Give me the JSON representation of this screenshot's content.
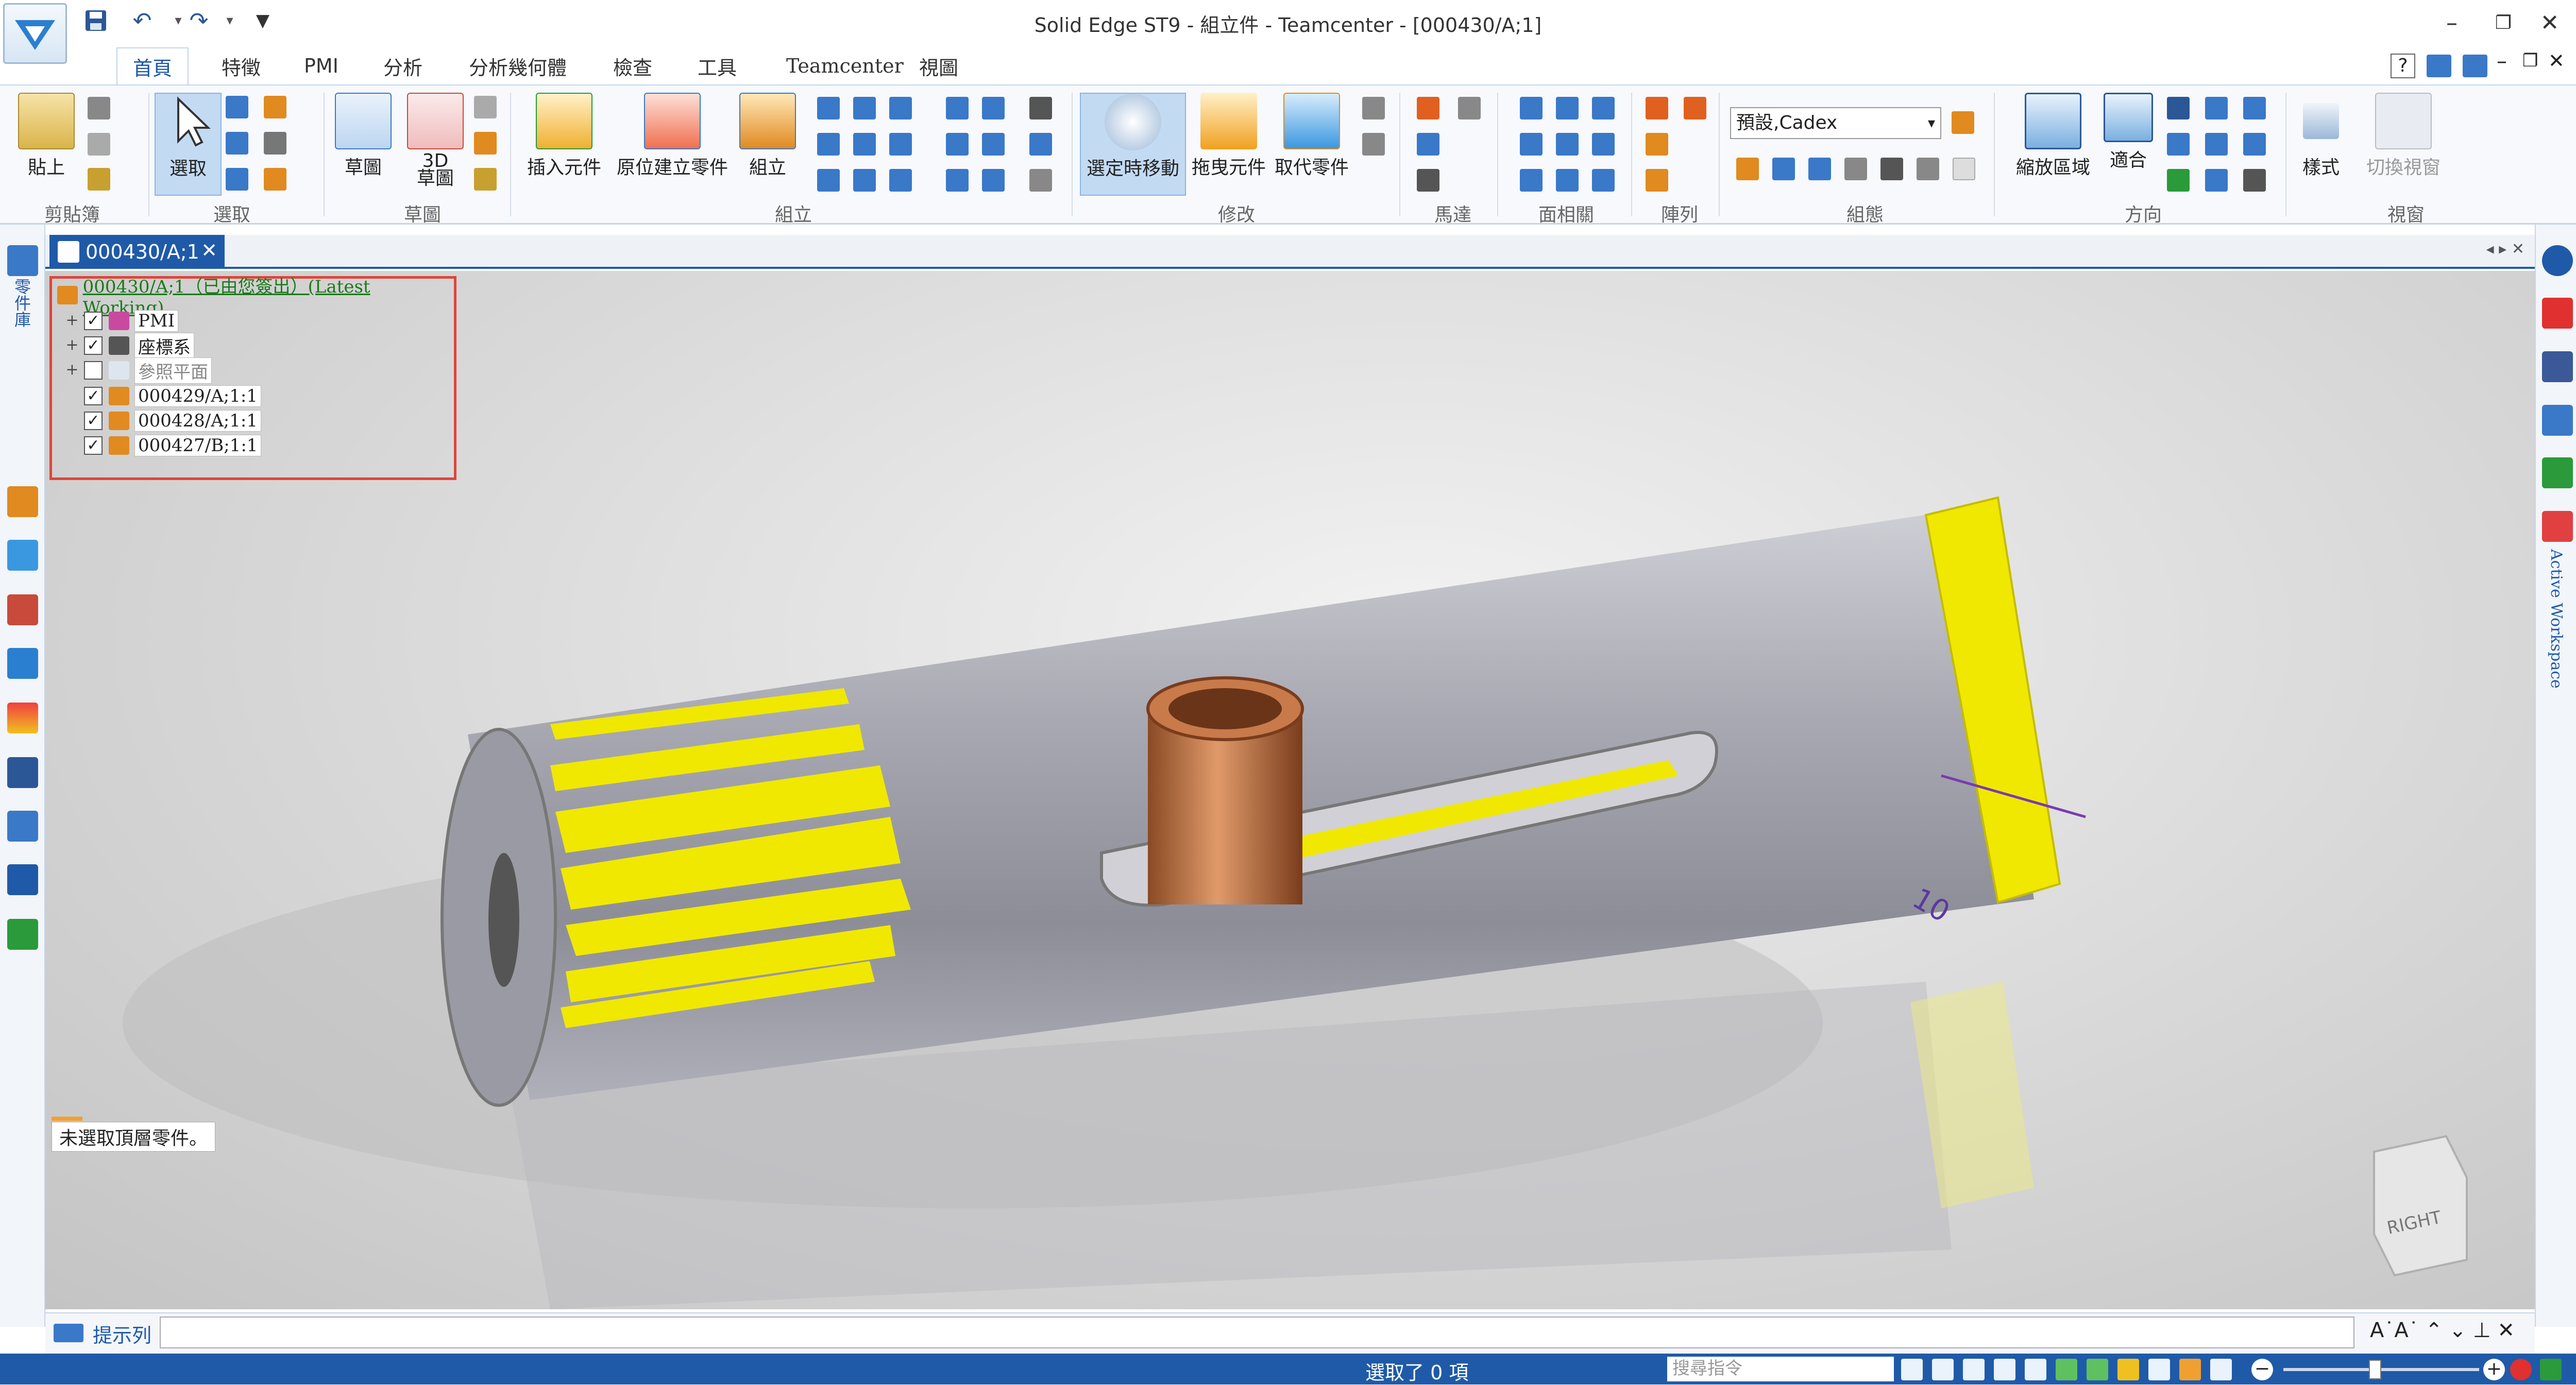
{
  "window": {
    "title": "Solid Edge ST9 - 組立件 - Teamcenter - [000430/A;1]"
  },
  "menu_tabs": [
    "首頁",
    "特徵",
    "PMI",
    "分析",
    "分析幾何體",
    "檢查",
    "工具",
    "Teamcenter",
    "視圖"
  ],
  "ribbon": {
    "groups": [
      "剪貼簿",
      "選取",
      "草圖",
      "組立",
      "修改",
      "馬達",
      "面相關",
      "陣列",
      "組態",
      "方向",
      "視窗"
    ],
    "buttons": {
      "paste": "貼上",
      "select": "選取",
      "sketch": "草圖",
      "sketch3d": "3D\n草圖",
      "insert_component": "插入元件",
      "create_in_place": "原位建立零件",
      "assemble": "組立",
      "select_move": "選定時移動",
      "drag_component": "拖曳元件",
      "replace_part": "取代零件",
      "zoom_area": "縮放區域",
      "fit": "適合",
      "styles": "樣式",
      "switch_window": "切換視窗"
    },
    "style_combo": "預設,Cadex"
  },
  "left_rail": {
    "library": "零件庫"
  },
  "right_rail": {
    "active_workspace": "Active Workspace"
  },
  "document_tab": "000430/A;1",
  "tree": {
    "root": "000430/A;1（已由您簽出）(Latest Working)",
    "items": [
      {
        "label": "PMI",
        "expander": true,
        "checked": true
      },
      {
        "label": "座標系",
        "expander": true,
        "checked": true
      },
      {
        "label": "參照平面",
        "expander": true,
        "checked": false
      },
      {
        "label": "000429/A;1:1",
        "expander": false,
        "checked": true
      },
      {
        "label": "000428/A;1:1",
        "expander": false,
        "checked": true
      },
      {
        "label": "000427/B;1:1",
        "expander": false,
        "checked": true
      }
    ]
  },
  "viewport": {
    "status_hint": "未選取頂層零件。",
    "dimension": "10",
    "view_cube": "RIGHT"
  },
  "prompt_bar": {
    "label": "提示列"
  },
  "status_bar": {
    "selection": "選取了 0 項",
    "command_search_placeholder": "搜尋指令"
  },
  "colors": {
    "accent": "#1f5aa8",
    "highlight": "#e0443a",
    "yellow": "#f0e800",
    "copper": "#c0784a"
  }
}
